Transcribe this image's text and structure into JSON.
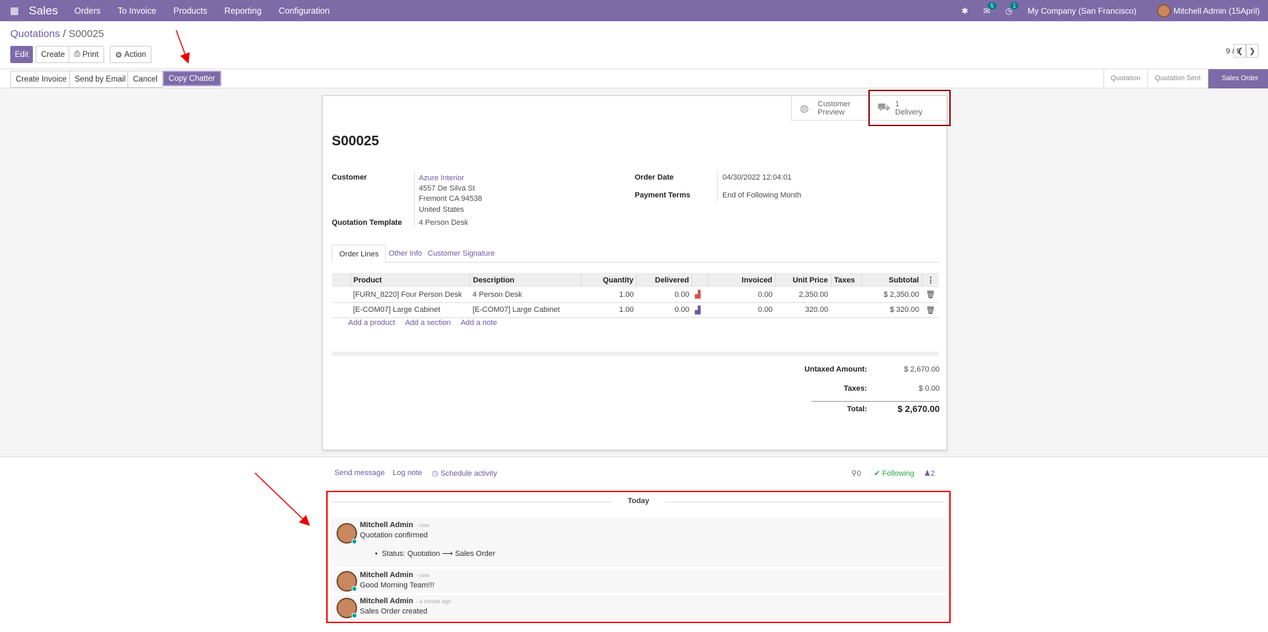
{
  "topbar": {
    "app": "Sales",
    "menu": [
      "Orders",
      "To Invoice",
      "Products",
      "Reporting",
      "Configuration"
    ],
    "chat_count": "5",
    "activity_count": "1",
    "company": "My Company (San Francisco)",
    "user": "Mitchell Admin (15April)"
  },
  "breadcrumb": {
    "parent": "Quotations",
    "sep": "/",
    "current": "S00025"
  },
  "toolbar": {
    "edit": "Edit",
    "create": "Create",
    "print": "Print",
    "action": "Action"
  },
  "pager": {
    "value": "9 / 9"
  },
  "header_buttons": [
    "Create Invoice",
    "Send by Email",
    "Cancel",
    "Copy Chatter"
  ],
  "status_steps": [
    "Quotation",
    "Quotation Sent",
    "Sales Order"
  ],
  "smart_buttons": {
    "preview_line1": "Customer",
    "preview_line2": "Preview",
    "delivery_count": "1",
    "delivery_label": "Delivery"
  },
  "order": {
    "name": "S00025",
    "customer_label": "Customer",
    "customer_name": "Azure Interior",
    "address1": "4557 De Silva St",
    "address2": "Fremont CA 94538",
    "address3": "United States",
    "template_label": "Quotation Template",
    "template_value": "4 Person Desk",
    "date_label": "Order Date",
    "date_value": "04/30/2022 12:04:01",
    "terms_label": "Payment Terms",
    "terms_value": "End of Following Month"
  },
  "tabs": [
    "Order Lines",
    "Other Info",
    "Customer Signature"
  ],
  "lines": {
    "headers": [
      "Product",
      "Description",
      "Quantity",
      "Delivered",
      "Invoiced",
      "Unit Price",
      "Taxes",
      "Subtotal"
    ],
    "rows": [
      {
        "product": "[FURN_8220] Four Person Desk",
        "description": "4 Person Desk",
        "qty": "1.00",
        "delivered": "0.00",
        "invoiced": "0.00",
        "price": "2,350.00",
        "taxes": "",
        "subtotal": "$ 2,350.00"
      },
      {
        "product": "[E-COM07] Large Cabinet",
        "description": "[E-COM07] Large Cabinet",
        "qty": "1.00",
        "delivered": "0.00",
        "invoiced": "0.00",
        "price": "320.00",
        "taxes": "",
        "subtotal": "$ 320.00"
      }
    ],
    "add": [
      "Add a product",
      "Add a section",
      "Add a note"
    ]
  },
  "totals": {
    "untaxed_label": "Untaxed Amount:",
    "untaxed": "$ 2,670.00",
    "taxes_label": "Taxes:",
    "taxes": "$ 0.00",
    "total_label": "Total:",
    "total": "$ 2,670.00"
  },
  "chatter": {
    "send": "Send message",
    "log": "Log note",
    "schedule": "Schedule activity",
    "attachments": "0",
    "following": "Following",
    "followers": "2",
    "day": "Today",
    "messages": [
      {
        "author": "Mitchell Admin",
        "when": "- now",
        "body": "Quotation confirmed",
        "tracking": "Status: Quotation ⟶ Sales Order"
      },
      {
        "author": "Mitchell Admin",
        "when": "- now",
        "body": "Good Morning Team!!!"
      },
      {
        "author": "Mitchell Admin",
        "when": "- a minute ago",
        "body": "Sales Order created"
      }
    ]
  }
}
